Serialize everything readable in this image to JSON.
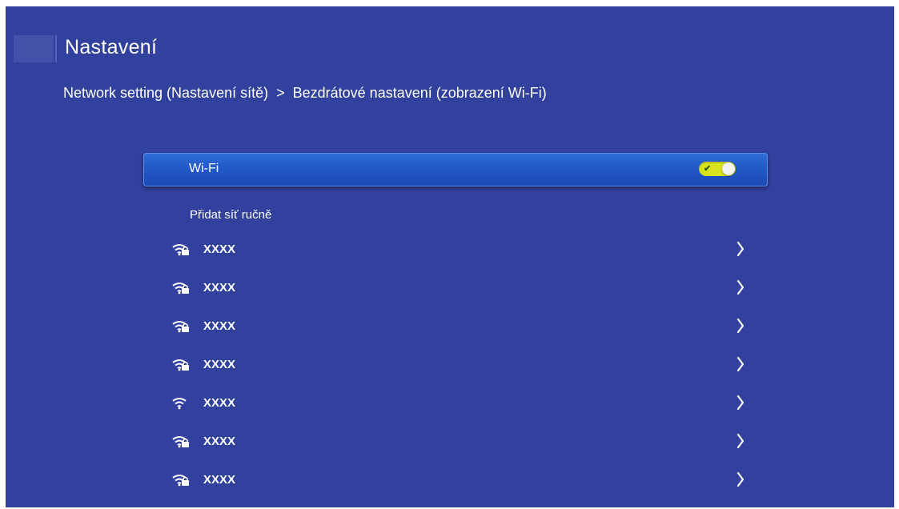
{
  "header": {
    "title": "Nastavení"
  },
  "breadcrumb": {
    "parent": "Network setting (Nastavení sítě)",
    "separator": ">",
    "current": "Bezdrátové nastavení (zobrazení Wi-Fi)"
  },
  "wifi": {
    "label": "Wi-Fi",
    "enabled": true,
    "toggle_color": "#d9e41f"
  },
  "manual": {
    "label": "Přidat síť ručně"
  },
  "networks": [
    {
      "name": "XXXX",
      "icon": "wifi-locked-icon",
      "secured": true
    },
    {
      "name": "XXXX",
      "icon": "wifi-locked-icon",
      "secured": true
    },
    {
      "name": "XXXX",
      "icon": "wifi-locked-icon",
      "secured": true
    },
    {
      "name": "XXXX",
      "icon": "wifi-locked-icon",
      "secured": true
    },
    {
      "name": "XXXX",
      "icon": "wifi-icon",
      "secured": false
    },
    {
      "name": "XXXX",
      "icon": "wifi-locked-icon",
      "secured": true
    },
    {
      "name": "XXXX",
      "icon": "wifi-locked-icon",
      "secured": true
    }
  ],
  "colors": {
    "background": "#31419d",
    "highlight": "#2259c8"
  }
}
